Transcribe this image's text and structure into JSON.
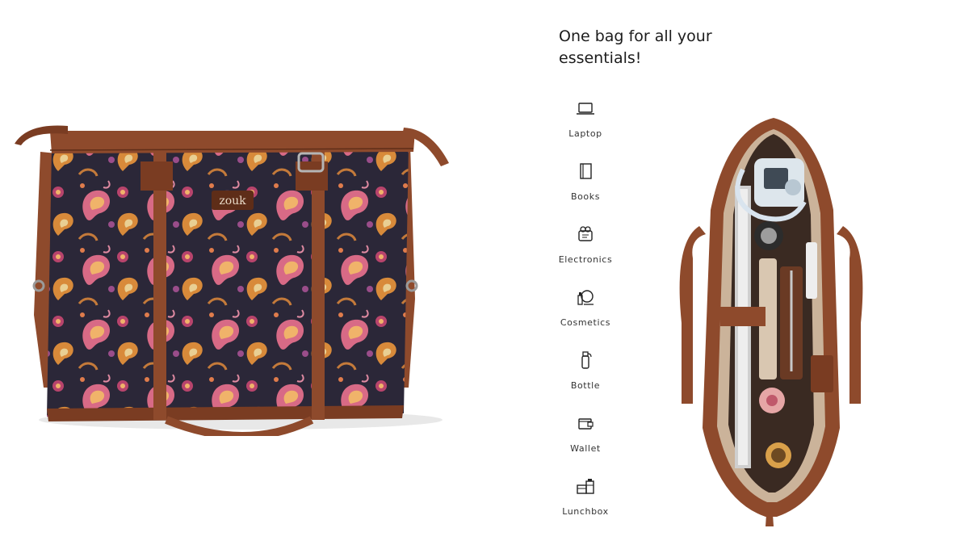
{
  "headline": "One bag for all your essentials!",
  "product": {
    "brand_label": "zouk",
    "colors": {
      "leather": "#8e4a2c",
      "leather_dark": "#5e2d18",
      "print_base": "#2b2738",
      "paisley_pink": "#d86a86",
      "paisley_orange": "#d88a3a"
    }
  },
  "features": [
    {
      "icon": "laptop-icon",
      "label": "Laptop"
    },
    {
      "icon": "book-icon",
      "label": "Books"
    },
    {
      "icon": "electronics-icon",
      "label": "Electronics"
    },
    {
      "icon": "cosmetics-icon",
      "label": "Cosmetics"
    },
    {
      "icon": "bottle-icon",
      "label": "Bottle"
    },
    {
      "icon": "wallet-icon",
      "label": "Wallet"
    },
    {
      "icon": "lunchbox-icon",
      "label": "Lunchbox"
    }
  ]
}
